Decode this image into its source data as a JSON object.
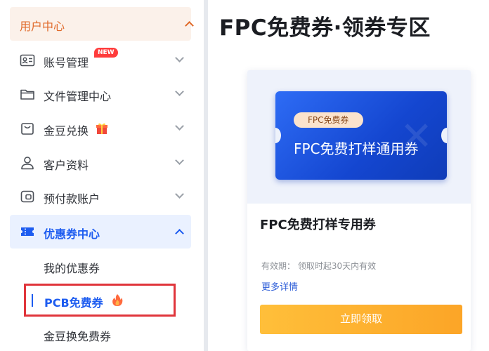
{
  "sidebar": {
    "header": {
      "label": "用户中心"
    },
    "items": [
      {
        "label": "账号管理",
        "badge": "NEW",
        "icon": "id-card-icon"
      },
      {
        "label": "文件管理中心",
        "icon": "folder-icon"
      },
      {
        "label": "金豆兑换",
        "icon": "bag-icon",
        "extra_icon": "gift-icon"
      },
      {
        "label": "客户资料",
        "icon": "user-icon"
      },
      {
        "label": "预付款账户",
        "icon": "wallet-icon"
      },
      {
        "label": "优惠券中心",
        "icon": "coupon-icon"
      }
    ],
    "subitems": [
      {
        "label": "我的优惠券"
      },
      {
        "label": "PCB免费券",
        "icon": "fire-icon"
      },
      {
        "label": "金豆换免费券"
      }
    ]
  },
  "main": {
    "title": "FPC免费券·领券专区",
    "card": {
      "coupon_tag": "FPC免费券",
      "coupon_name": "FPC免费打样通用券",
      "title": "FPC免费打样专用券",
      "validity": "有效期： 领取时起30天内有效",
      "more": "更多详情",
      "button": "立即领取"
    }
  },
  "colors": {
    "accent_orange": "#e06a2a",
    "accent_blue": "#1d5cf0",
    "button": "#fca527",
    "highlight_border": "#e0353b"
  }
}
